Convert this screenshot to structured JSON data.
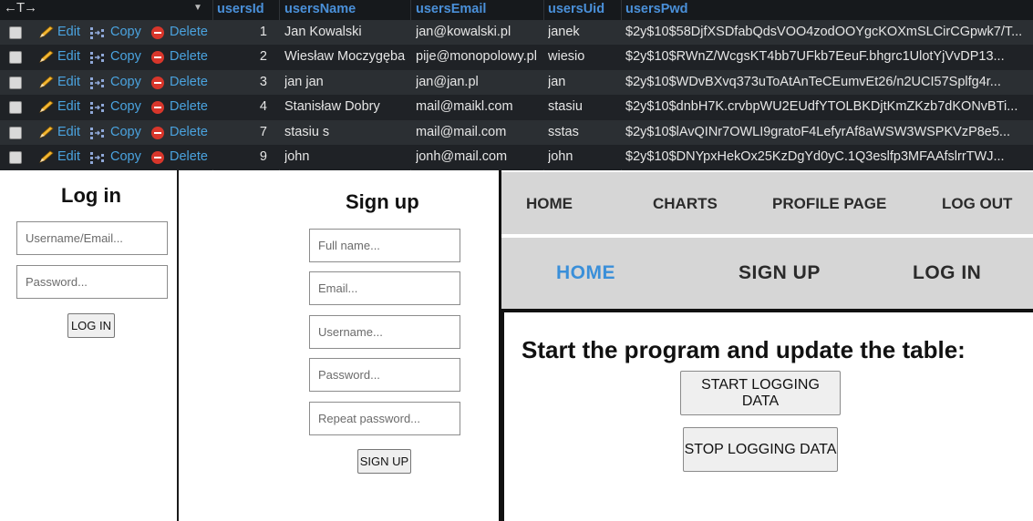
{
  "db_table": {
    "header_arrows": "←T→",
    "columns": [
      "usersId",
      "usersName",
      "usersEmail",
      "usersUid",
      "usersPwd"
    ],
    "actions": {
      "edit": "Edit",
      "copy": "Copy",
      "delete": "Delete"
    },
    "rows": [
      {
        "id": "1",
        "name": "Jan Kowalski",
        "email": "jan@kowalski.pl",
        "uid": "janek",
        "pwd": "$2y$10$58DjfXSDfabQdsVOO4zodOOYgcKOXmSLCirCGpwk7/T..."
      },
      {
        "id": "2",
        "name": "Wiesław Moczygęba",
        "email": "pije@monopolowy.pl",
        "uid": "wiesio",
        "pwd": "$2y$10$RWnZ/WcgsKT4bb7UFkb7EeuF.bhgrc1UlotYjVvDP13..."
      },
      {
        "id": "3",
        "name": "jan jan",
        "email": "jan@jan.pl",
        "uid": "jan",
        "pwd": "$2y$10$WDvBXvq373uToAtAnTeCEumvEt26/n2UCI57Splfg4r..."
      },
      {
        "id": "4",
        "name": "Stanisław Dobry",
        "email": "mail@maikl.com",
        "uid": "stasiu",
        "pwd": "$2y$10$dnbH7K.crvbpWU2EUdfYTOLBKDjtKmZKzb7dKONvBTi..."
      },
      {
        "id": "7",
        "name": "stasiu s",
        "email": "mail@mail.com",
        "uid": "sstas",
        "pwd": "$2y$10$lAvQINr7OWLI9gratoF4LefyrAf8aWSW3WSPKVzP8e5..."
      },
      {
        "id": "9",
        "name": "john",
        "email": "jonh@mail.com",
        "uid": "john",
        "pwd": "$2y$10$DNYpxHekOx25KzDgYd0yC.1Q3eslfp3MFAAfslrrTWJ..."
      }
    ]
  },
  "login": {
    "title": "Log in",
    "username_placeholder": "Username/Email...",
    "password_placeholder": "Password...",
    "button": "LOG IN"
  },
  "signup": {
    "title": "Sign up",
    "fullname_placeholder": "Full name...",
    "email_placeholder": "Email...",
    "username_placeholder": "Username...",
    "password_placeholder": "Password...",
    "repeat_placeholder": "Repeat password...",
    "button": "SIGN UP"
  },
  "nav_logged_in": {
    "home": "HOME",
    "charts": "CHARTS",
    "profile": "PROFILE PAGE",
    "logout": "LOG OUT"
  },
  "nav_logged_out": {
    "home": "HOME",
    "signup": "SIGN UP",
    "login": "LOG IN"
  },
  "program": {
    "heading": "Start the program and update the table:",
    "start_button": "START LOGGING DATA",
    "stop_button": "STOP LOGGING DATA"
  },
  "colors": {
    "accent_blue": "#3a8fd9",
    "link_blue": "#4aa3df",
    "delete_red": "#d8362b"
  }
}
